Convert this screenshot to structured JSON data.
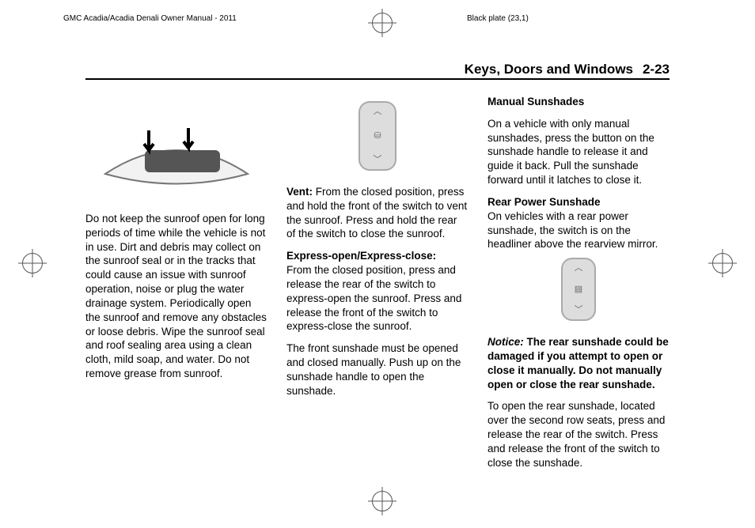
{
  "crop": {
    "manual_title": "GMC Acadia/Acadia Denali Owner Manual - 2011",
    "plate": "Black plate (23,1)"
  },
  "header": {
    "section": "Keys, Doors and Windows",
    "page": "2-23"
  },
  "col1": {
    "p1": "Do not keep the sunroof open for long periods of time while the vehicle is not in use. Dirt and debris may collect on the sunroof seal or in the tracks that could cause an issue with sunroof operation, noise or plug the water drainage system. Periodically open the sunroof and remove any obstacles or loose debris. Wipe the sunroof seal and roof sealing area using a clean cloth, mild soap, and water. Do not remove grease from sunroof."
  },
  "col2": {
    "vent_label": "Vent:",
    "vent_body": "  From the closed position, press and hold the front of the switch to vent the sunroof. Press and hold the rear of the switch to close the sunroof.",
    "exp_label": "Express-open/Express-close:",
    "exp_body": "From the closed position, press and release the rear of the switch to express-open the sunroof. Press and release the front of the switch to express-close the sunroof.",
    "p3": "The front sunshade must be opened and closed manually. Push up on the sunshade handle to open the sunshade."
  },
  "col3": {
    "h1": "Manual Sunshades",
    "p1": "On a vehicle with only manual sunshades, press the button on the sunshade handle to release it and guide it back. Pull the sunshade forward until it latches to close it.",
    "h2": "Rear Power Sunshade",
    "p2": "On vehicles with a rear power sunshade, the switch is on the headliner above the rearview mirror.",
    "notice_label": "Notice:",
    "notice_body": "  The rear sunshade could be damaged if you attempt to open or close it manually. Do not manually open or close the rear sunshade.",
    "p3": "To open the rear sunshade, located over the second row seats, press and release the rear of the switch. Press and release the front of the switch to close the sunshade."
  },
  "icons": {
    "sunroof_switch": "sunroof-switch-glyph",
    "rear_sunshade_switch": "rear-sunshade-switch-glyph"
  }
}
